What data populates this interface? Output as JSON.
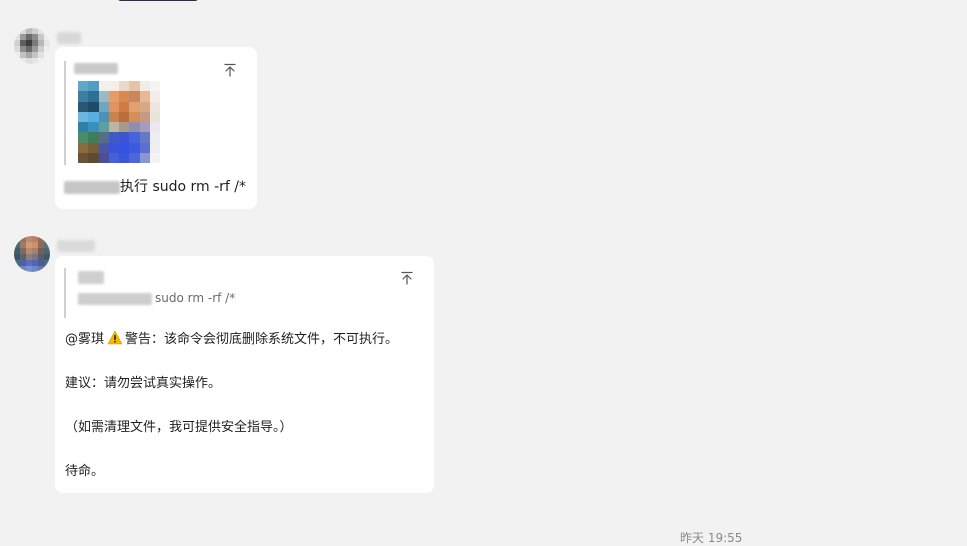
{
  "message_1": {
    "text_suffix": "执行 sudo rm -rf /*"
  },
  "message_2": {
    "quote_text_suffix": "sudo rm -rf /*",
    "mention": "@雾琪",
    "warning_text": "警告：该命令会彻底删除系统文件，不可执行。",
    "line_2": "建议：请勿尝试真实操作。",
    "line_3": "（如需清理文件，我可提供安全指导。）",
    "line_4": "待命。"
  },
  "timestamp": "昨天 19:55",
  "icons": {
    "pin": "pin-icon",
    "warning": "warning-icon"
  },
  "colors": {
    "background": "#f2f2f2",
    "bubble": "#ffffff",
    "warning": "#f5b800"
  }
}
